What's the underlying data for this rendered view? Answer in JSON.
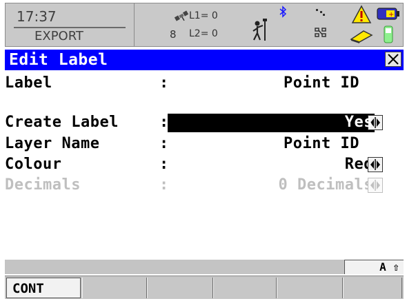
{
  "status": {
    "time": "17:37",
    "app": "EXPORT",
    "satellites": "8",
    "l1": "L1= 0",
    "l2": "L2= 0"
  },
  "title": "Edit Label",
  "rows": [
    {
      "label": "Label",
      "colon": ":",
      "value": "Point ID",
      "state": "normal"
    },
    {
      "label": "Create Label",
      "colon": ":",
      "value": "Yes",
      "state": "selected"
    },
    {
      "label": "Layer Name",
      "colon": ":",
      "value": "Point ID",
      "state": "normal"
    },
    {
      "label": "Colour",
      "colon": ":",
      "value": "Red",
      "state": "normal"
    },
    {
      "label": "Decimals",
      "colon": ":",
      "value": "0 Decimals",
      "state": "disabled"
    }
  ],
  "input_mode": "A ⇧",
  "softkeys": [
    "CONT",
    "",
    "",
    "",
    "",
    ""
  ],
  "colors": {
    "title_bar": "#0000ff",
    "status_bar": "#c9c9c9",
    "selection": "#000000",
    "disabled_text": "#bfbfbf"
  },
  "icons": [
    "satellite-icon",
    "bluetooth-icon",
    "surveyor-icon",
    "radio-link-icon",
    "warning-icon",
    "battery-icon",
    "memory-card-icon",
    "controller-icon"
  ]
}
